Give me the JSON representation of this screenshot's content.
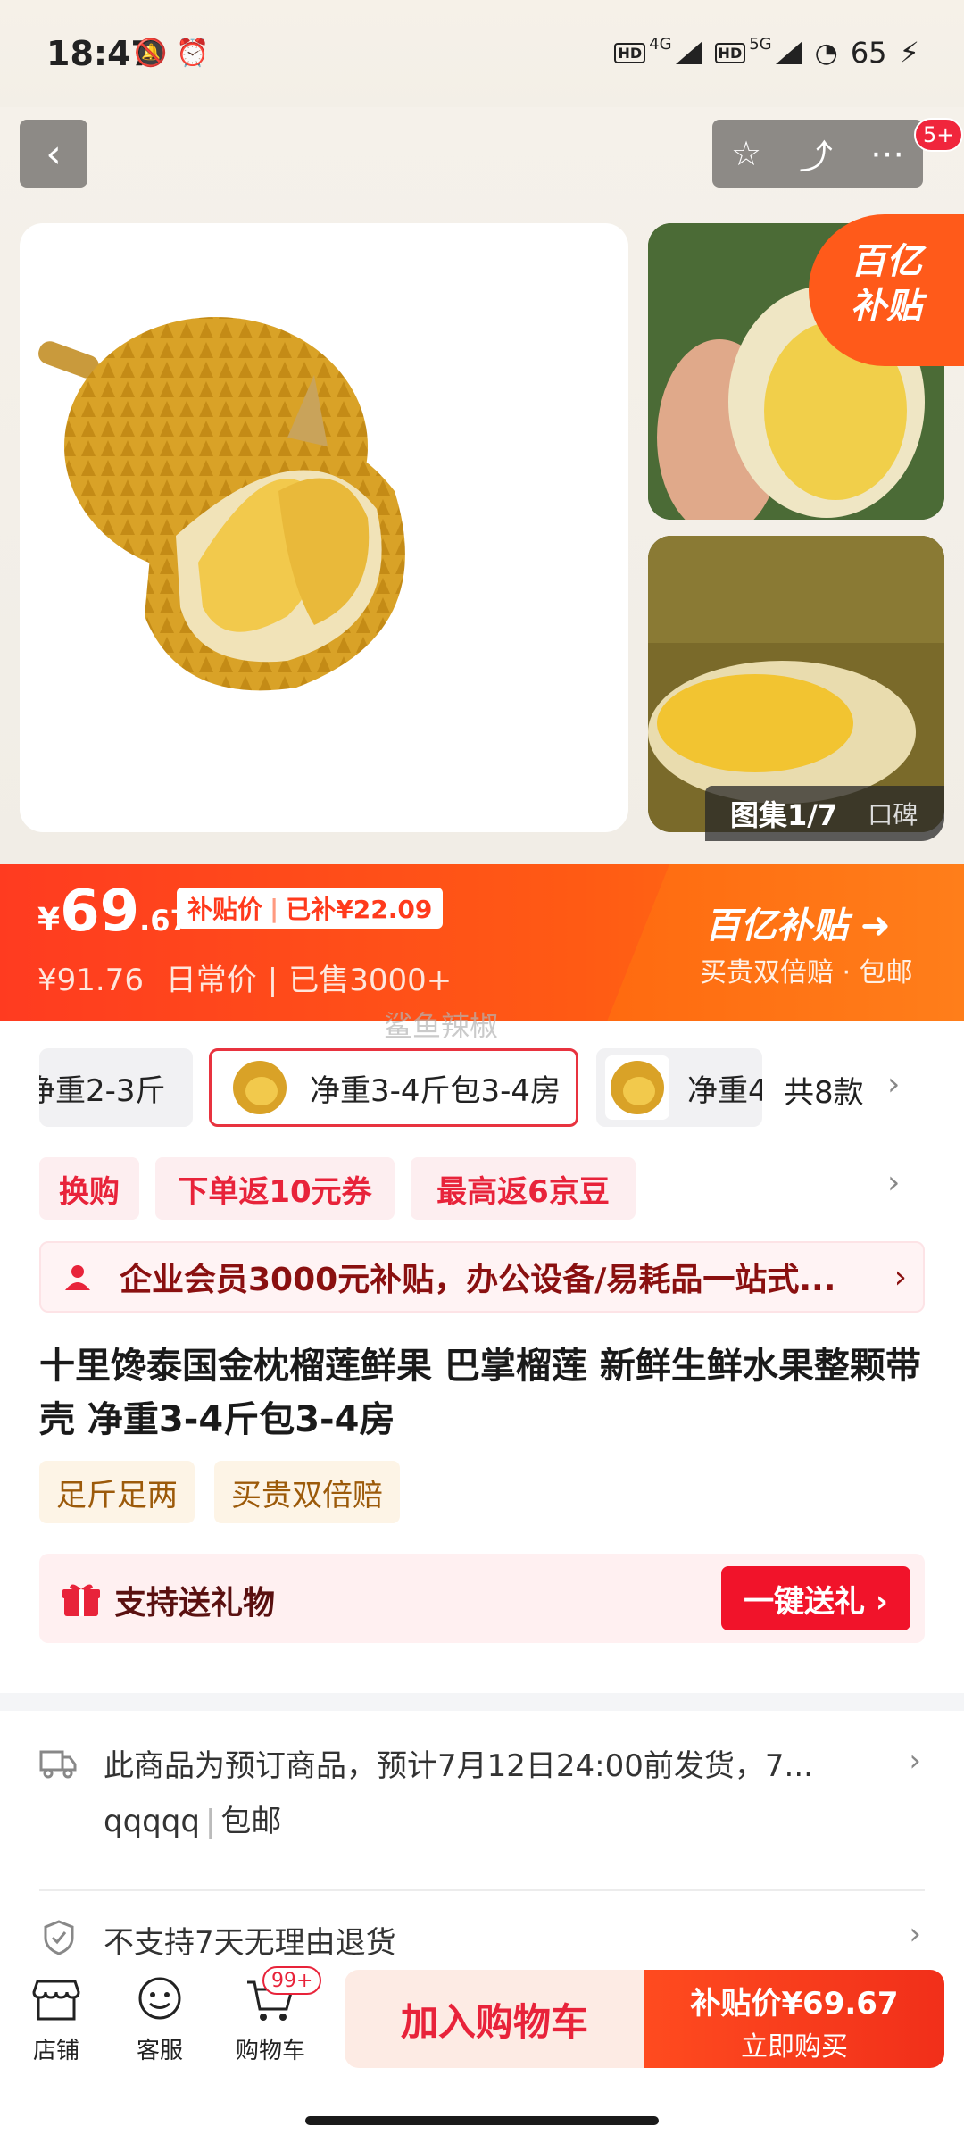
{
  "status_bar": {
    "time": "18:47",
    "network_1": "4G",
    "network_2": "5G",
    "battery": "65"
  },
  "header": {
    "message_badge": "5+"
  },
  "gallery": {
    "album_label": "图集1/7",
    "review_label": "口碑",
    "subsidy_corner_line1": "百亿",
    "subsidy_corner_line2": "补贴"
  },
  "price": {
    "currency": "¥",
    "integer": "69",
    "decimal": ".67",
    "tag_label": "补贴价",
    "tag_saved": "已补¥22.09",
    "daily_price": "¥91.76",
    "daily_label": "日常价",
    "sold": "已售3000+",
    "program_title": "百亿补贴",
    "program_sub": "买贵双倍赔 · 包邮"
  },
  "watermark": "鲨鱼辣椒",
  "variants": {
    "items": [
      {
        "label": "净重2-3斤"
      },
      {
        "label": "净重3-4斤包3-4房"
      },
      {
        "label": "净重4"
      }
    ],
    "count_label": "共8款"
  },
  "promos": [
    "换购",
    "下单返10元券",
    "最高返6京豆"
  ],
  "enterprise_banner": "企业会员3000元补贴，办公设备/易耗品一站式...",
  "product_title": "十里馋泰国金枕榴莲鲜果 巴掌榴莲 新鲜生鲜水果整颗带壳 净重3-4斤包3-4房",
  "tags": [
    "足斤足两",
    "买贵双倍赔"
  ],
  "gift": {
    "label": "支持送礼物",
    "button": "一键送礼 ›"
  },
  "shipping": {
    "text": "此商品为预订商品，预计7月12日24:00前发货，7...",
    "sub_1": "qqqqq",
    "sub_2": "包邮"
  },
  "returns": {
    "text": "不支持7天无理由退货"
  },
  "bottom_bar": {
    "store": "店铺",
    "service": "客服",
    "cart": "购物车",
    "cart_badge": "99+",
    "add_to_cart": "加入购物车",
    "buy_price_label": "补贴价¥69.67",
    "buy_now": "立即购买"
  },
  "colors": {
    "brand_red": "#f1132a",
    "subsidy_orange": "#ff5a14"
  }
}
